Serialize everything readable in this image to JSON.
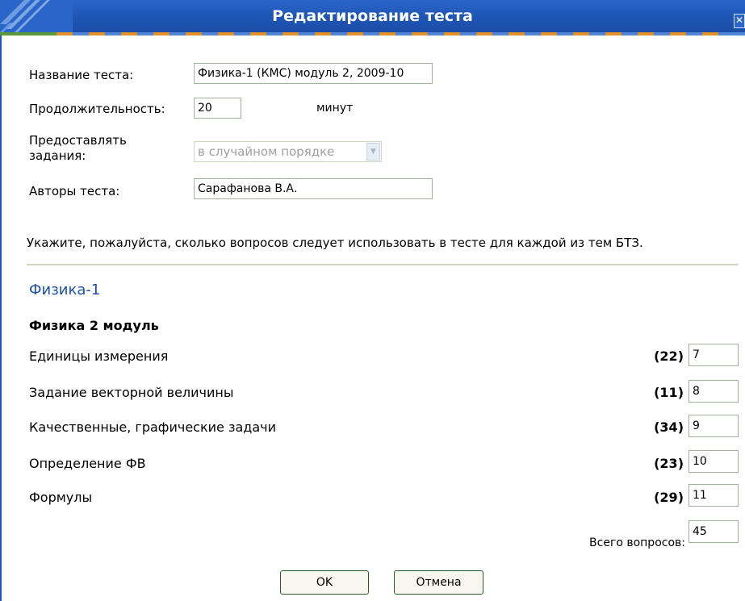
{
  "window": {
    "title": "Редактирование теста",
    "close_icon": "close-icon",
    "accent": "#1e55b4"
  },
  "form": {
    "name_label": "Название теста:",
    "name_value": "Физика-1 (КМС) модуль 2, 2009-10",
    "duration_label": "Продолжительность:",
    "duration_value": "20",
    "duration_unit": "минут",
    "order_label_line1": "Предоставлять",
    "order_label_line2": "задания:",
    "order_value": "в случайном порядке",
    "authors_label": "Авторы теста:",
    "authors_value": "Сарафанова В.А."
  },
  "hint": "Укажите, пожалуйста, сколько вопросов следует использовать в тесте для каждой из тем БТЗ.",
  "section_title": "Физика-1",
  "subsection_title": "Физика 2 модуль",
  "topics": [
    {
      "name": "Единицы измерения",
      "available": "(22)",
      "value": "7"
    },
    {
      "name": "Задание векторной величины",
      "available": "(11)",
      "value": "8"
    },
    {
      "name": "Качественные, графические задачи",
      "available": "(34)",
      "value": "9"
    },
    {
      "name": "Определение ФВ",
      "available": "(23)",
      "value": "10"
    },
    {
      "name": "Формулы",
      "available": "(29)",
      "value": "11"
    }
  ],
  "total": {
    "label": "Всего вопросов:",
    "value": "45"
  },
  "buttons": {
    "ok": "OK",
    "cancel": "Отмена"
  }
}
